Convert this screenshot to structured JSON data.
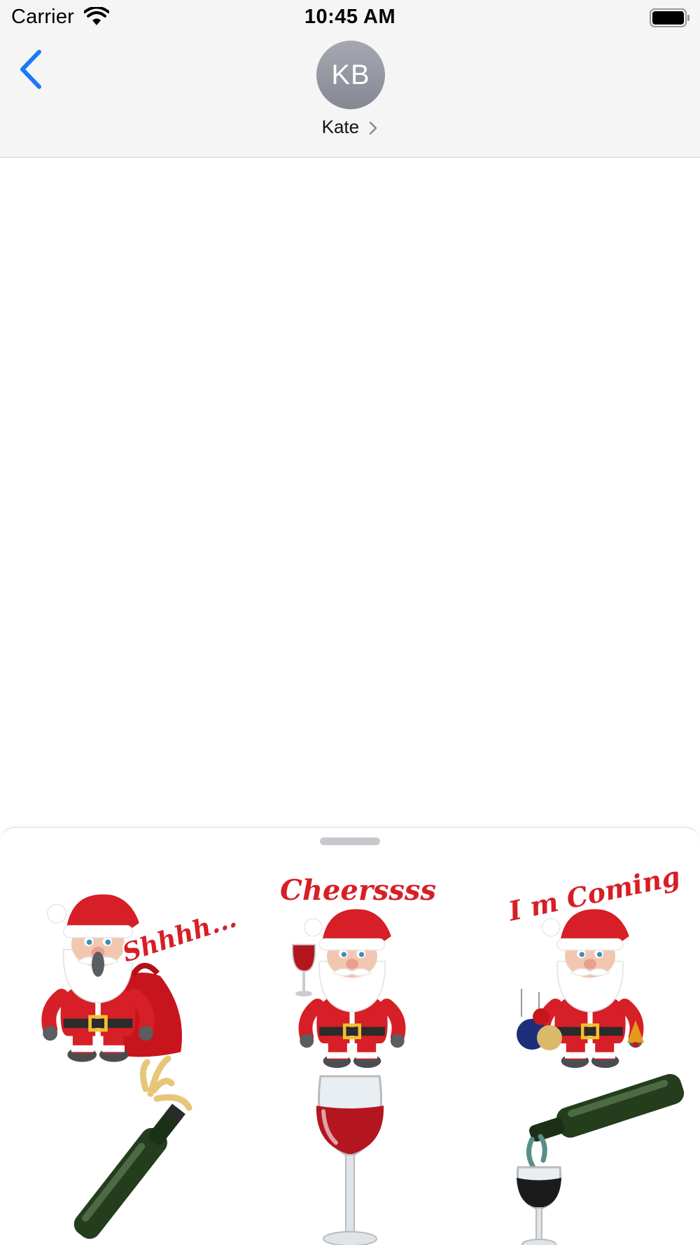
{
  "status_bar": {
    "carrier": "Carrier",
    "time": "10:45 AM",
    "wifi_icon": "wifi-icon",
    "battery_icon": "battery-full-icon"
  },
  "nav": {
    "back_icon": "chevron-left-icon",
    "contact_initials": "KB",
    "contact_name": "Kate",
    "contact_chevron_icon": "chevron-right-icon"
  },
  "colors": {
    "accent": "#1a7cf5",
    "header_bg": "#f6f5f6",
    "avatar": "#8e9099",
    "sticker_red": "#d61f26"
  },
  "stickers": [
    {
      "caption": "Shhhh...",
      "icon": "santa-shh-sticker"
    },
    {
      "caption": "Cheerssss",
      "icon": "santa-cheers-sticker"
    },
    {
      "caption": "I m Coming",
      "icon": "santa-coming-sticker"
    },
    {
      "caption": "",
      "icon": "champagne-pop-sticker"
    },
    {
      "caption": "",
      "icon": "red-wine-glass-sticker"
    },
    {
      "caption": "",
      "icon": "wine-pour-sticker"
    }
  ]
}
